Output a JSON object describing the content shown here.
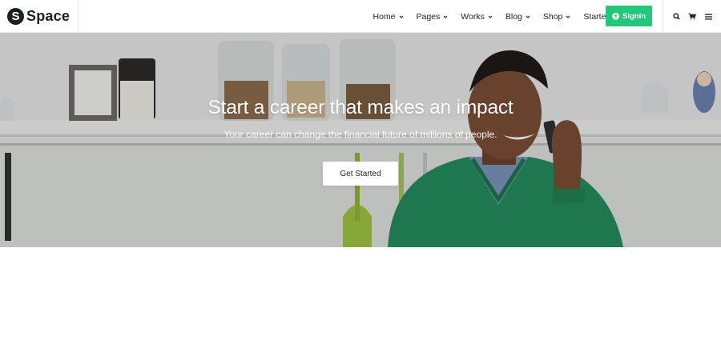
{
  "brand": {
    "mark": "S",
    "name": "Space"
  },
  "nav": {
    "items": [
      {
        "label": "Home",
        "dropdown": true
      },
      {
        "label": "Pages",
        "dropdown": true
      },
      {
        "label": "Works",
        "dropdown": true
      },
      {
        "label": "Blog",
        "dropdown": true
      },
      {
        "label": "Shop",
        "dropdown": true
      },
      {
        "label": "Starter",
        "dropdown": false
      }
    ],
    "signin_label": "Signin"
  },
  "hero": {
    "title": "Start a career that makes an impact",
    "subtitle": "Your career can change the financial future of millions of people.",
    "cta_label": "Get Started"
  },
  "colors": {
    "accent": "#21c87a",
    "text_dark": "#1e2022",
    "sweater": "#1f8a5a"
  },
  "icons": {
    "search": "search-icon",
    "cart": "cart-icon",
    "menu": "menu-icon",
    "user": "user-circle-icon",
    "chevron": "chevron-down-icon"
  }
}
